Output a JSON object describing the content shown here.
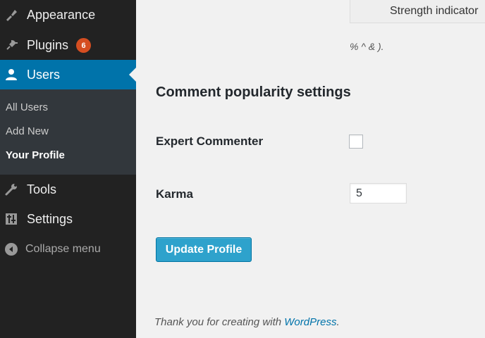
{
  "sidebar": {
    "menu": [
      {
        "id": "appearance",
        "label": "Appearance",
        "icon": "paintbrush-icon"
      },
      {
        "id": "plugins",
        "label": "Plugins",
        "icon": "plug-icon",
        "badge": "6"
      },
      {
        "id": "users",
        "label": "Users",
        "icon": "user-icon",
        "active": true
      },
      {
        "id": "tools",
        "label": "Tools",
        "icon": "wrench-icon"
      },
      {
        "id": "settings",
        "label": "Settings",
        "icon": "sliders-icon"
      }
    ],
    "submenu": [
      {
        "label": "All Users"
      },
      {
        "label": "Add New"
      },
      {
        "label": "Your Profile",
        "current": true
      }
    ],
    "collapse_label": "Collapse menu"
  },
  "main": {
    "strength_label": "Strength indicator",
    "hint_text": "% ^ & ).",
    "section_title": "Comment popularity settings",
    "fields": {
      "expert_commenter_label": "Expert Commenter",
      "expert_commenter_checked": false,
      "karma_label": "Karma",
      "karma_value": "5"
    },
    "update_button": "Update Profile"
  },
  "footer": {
    "prefix": "Thank you for creating with ",
    "link": "WordPress",
    "suffix": "."
  },
  "colors": {
    "sidebar_bg": "#222222",
    "submenu_bg": "#32373c",
    "active_bg": "#0073aa",
    "badge_bg": "#d54e21",
    "button_bg": "#2ea2cc",
    "link": "#0073aa",
    "content_bg": "#f1f1f1"
  }
}
